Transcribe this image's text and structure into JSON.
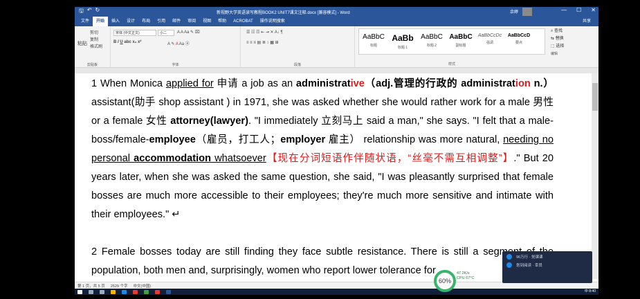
{
  "window": {
    "title": "新视野大学英语读写教程BOOK2 UNIT7课文注释.docx [兼容模式] - Word",
    "user": "余婷",
    "controls": [
      "—",
      "☐",
      "✕"
    ]
  },
  "qat": {
    "save": "🖫",
    "undo": "↶",
    "redo": "↻"
  },
  "tabs": [
    "文件",
    "开始",
    "插入",
    "设计",
    "布局",
    "引用",
    "邮件",
    "审阅",
    "视图",
    "帮助",
    "ACROBAT",
    "操作说明搜索"
  ],
  "active_tab": "开始",
  "share": "共享",
  "ribbon": {
    "clipboard": {
      "paste": "粘贴",
      "cut": "剪切",
      "copy": "复制",
      "format_painter": "格式刷",
      "label": "剪贴板"
    },
    "font": {
      "family": "宋体 (中文正文)",
      "size": "小二",
      "label": "字体"
    },
    "paragraph": {
      "label": "段落"
    },
    "styles": {
      "label": "样式",
      "items": [
        {
          "sample": "AaBbC",
          "name": "标题"
        },
        {
          "sample": "AaBb",
          "name": "标题 1"
        },
        {
          "sample": "AaBbC",
          "name": "标题 2"
        },
        {
          "sample": "AaBbC",
          "name": "副标题"
        },
        {
          "sample": "AaBbCcDc",
          "name": "强调"
        },
        {
          "sample": "AaBbCcD",
          "name": "要点"
        }
      ]
    },
    "editing": {
      "find": "查找",
      "replace": "替换",
      "select": "选择",
      "label": "编辑"
    }
  },
  "document": {
    "p1": {
      "num": "1 When Monica ",
      "applied_for": "applied for",
      "cn1": " 申请 a job as an ",
      "admin_pre": "administrat",
      "admin_ive": "ive",
      "admin_note": "（adj.管理的行政的",
      "admin2_pre": "administrat",
      "admin2_ion": "ion",
      "admin2_n": " n.）",
      "assistant": " assistant(助手 shop assistant ) in 1971, she was asked whether she would rather work for a male 男性 or a female 女性 ",
      "attorney": "attorney(lawyer)",
      "quote1": ". \"I immediately 立刻马上 said a man,\" she says. \"I felt that a male-boss/female-",
      "employee": "employee",
      "employee_cn": "（雇员，打工人；",
      "employer": "employer",
      "employer_cn": " 雇主）",
      "relationship": " relationship was more natural, ",
      "needing": "needing no personal ",
      "accommodation": "accommodation",
      "whatsoever": " whatsoever",
      "note": "【现在分词短语作伴随状语，“丝毫不需互相调整”】",
      "rest": ".\" But 20 years later, when she was asked the same question, she said, \"I was pleasantly surprised that female bosses are much more accessible to their employees; they're much more sensitive and intimate with their employees.\" ↵"
    },
    "p2": "2 Female bosses today are still finding they face subtle resistance. There is still a segment of the population, both men and, surprisingly, women who report lower tolerance for"
  },
  "statusbar": {
    "page": "第 1 页，共 5 页",
    "words": "2529 个字",
    "lang": "中文(中国)"
  },
  "gauge": {
    "percent": "60%",
    "net_speed": "47.2K/s",
    "cpu": "CPU 67°C"
  },
  "notification": {
    "line1": "96万行 · 党课课",
    "line2": "划到阅读 · 幸员"
  },
  "tray": {
    "time": "8:40",
    "ime": "中"
  }
}
